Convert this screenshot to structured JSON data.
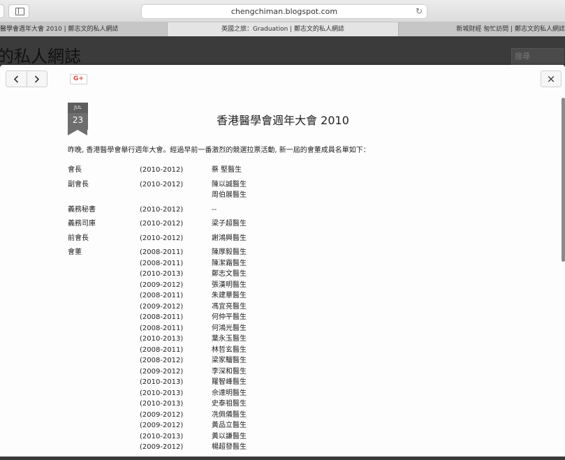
{
  "browser": {
    "url": "chengchiman.blogspot.com",
    "tabs": [
      {
        "label": "醫學會週年大會 2010 | 鄭志文的私人網誌"
      },
      {
        "label": "英國之旅：Graduation | 鄭志文的私人網誌"
      },
      {
        "label": "新城財經 匆忙訪問 | 鄭志文的私人網誌"
      }
    ]
  },
  "blog": {
    "title": "的私人網誌",
    "search_placeholder": "搜尋"
  },
  "modal": {
    "prev_icon": "chevron-left-icon",
    "next_icon": "chevron-right-icon",
    "share_label": "G+",
    "close_label": "×",
    "date": {
      "month": "JUL",
      "day": "23"
    },
    "title": "香港醫學會週年大會 2010",
    "intro": "昨晚, 香港醫學會舉行週年大會。經過早前一番激烈的競選拉票活動, 新一屆的會董成員名單如下：",
    "rows": [
      {
        "position": "會長",
        "term": "(2010-2012)",
        "name": "蔡  堅醫生"
      },
      {
        "position": "副會長",
        "term": "(2010-2012)",
        "name": "陳以誠醫生"
      },
      {
        "position": "",
        "term": "",
        "name": "周伯展醫生"
      },
      {
        "position": "義務秘書",
        "term": "(2010-2012)",
        "name": "--"
      },
      {
        "position": "義務司庫",
        "term": "(2010-2012)",
        "name": "梁子超醫生"
      },
      {
        "position": "前會長",
        "term": "(2010-2012)",
        "name": "謝鴻興醫生"
      },
      {
        "position": "會董",
        "term": "(2008-2011)",
        "name": "陳厚毅醫生"
      },
      {
        "position": "",
        "term": "(2008-2011)",
        "name": "陳潔霜醫生"
      },
      {
        "position": "",
        "term": "(2010-2013)",
        "name": "鄭志文醫生"
      },
      {
        "position": "",
        "term": "(2009-2012)",
        "name": "張漢明醫生"
      },
      {
        "position": "",
        "term": "(2008-2011)",
        "name": "朱建華醫生"
      },
      {
        "position": "",
        "term": "(2009-2012)",
        "name": "馮宜亮醫生"
      },
      {
        "position": "",
        "term": "(2008-2011)",
        "name": "何仲平醫生"
      },
      {
        "position": "",
        "term": "(2008-2011)",
        "name": "何鴻光醫生"
      },
      {
        "position": "",
        "term": "(2010-2013)",
        "name": "葉永玉醫生"
      },
      {
        "position": "",
        "term": "(2008-2011)",
        "name": "林哲玄醫生"
      },
      {
        "position": "",
        "term": "(2008-2012)",
        "name": "梁家騮醫生"
      },
      {
        "position": "",
        "term": "(2009-2012)",
        "name": "李深和醫生"
      },
      {
        "position": "",
        "term": "(2010-2013)",
        "name": "羅智峰醫生"
      },
      {
        "position": "",
        "term": "(2010-2013)",
        "name": "佘達明醫生"
      },
      {
        "position": "",
        "term": "(2010-2013)",
        "name": "史泰祖醫生"
      },
      {
        "position": "",
        "term": "(2009-2012)",
        "name": "冼佩儀醫生"
      },
      {
        "position": "",
        "term": "(2009-2012)",
        "name": "黃品立醫生"
      },
      {
        "position": "",
        "term": "(2010-2013)",
        "name": "黃以謙醫生"
      },
      {
        "position": "",
        "term": "(2009-2012)",
        "name": "楊超發醫生"
      }
    ]
  }
}
